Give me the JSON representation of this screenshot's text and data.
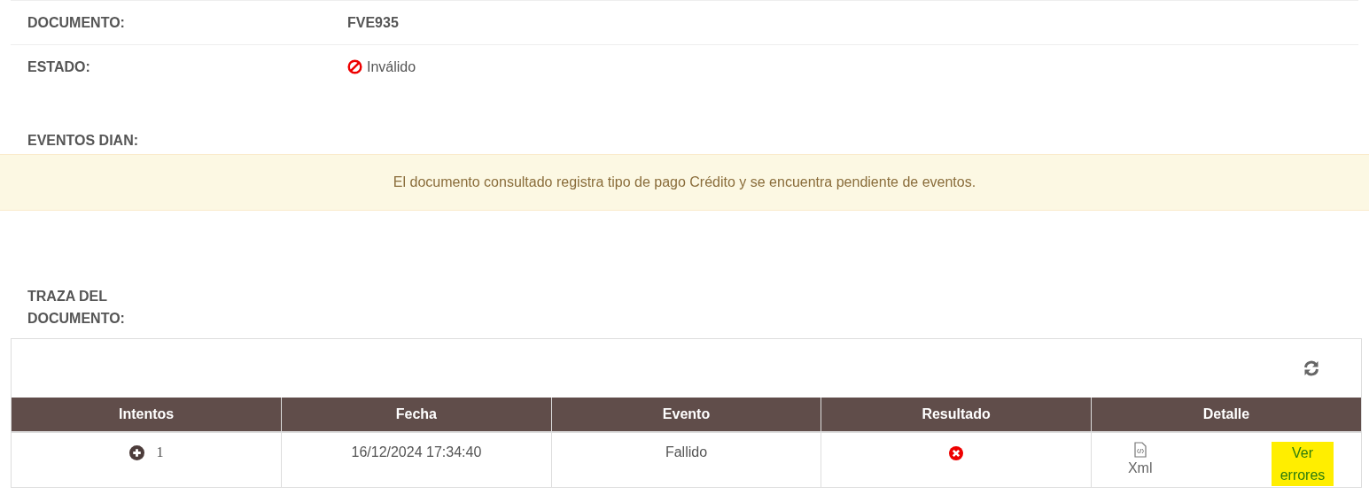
{
  "fields": [
    {
      "label": "DOCUMENTO:",
      "value": "FVE935",
      "kind": "code"
    },
    {
      "label": "ESTADO:",
      "value": "Inválido",
      "kind": "status"
    }
  ],
  "events": {
    "label": "EVENTOS DIAN:",
    "alert": "El documento consultado registra tipo de pago Crédito y se encuentra pendiente de eventos."
  },
  "trace": {
    "label": "TRAZA DEL DOCUMENTO:",
    "columns": [
      "Intentos",
      "Fecha",
      "Evento",
      "Resultado",
      "Detalle"
    ],
    "rows": [
      {
        "attempts": "1",
        "date": "16/12/2024 17:34:40",
        "event": "Fallido",
        "failed": true,
        "xml": "Xml",
        "errors_link": {
          "text": "Ver errores",
          "highlighted": true
        }
      }
    ]
  }
}
